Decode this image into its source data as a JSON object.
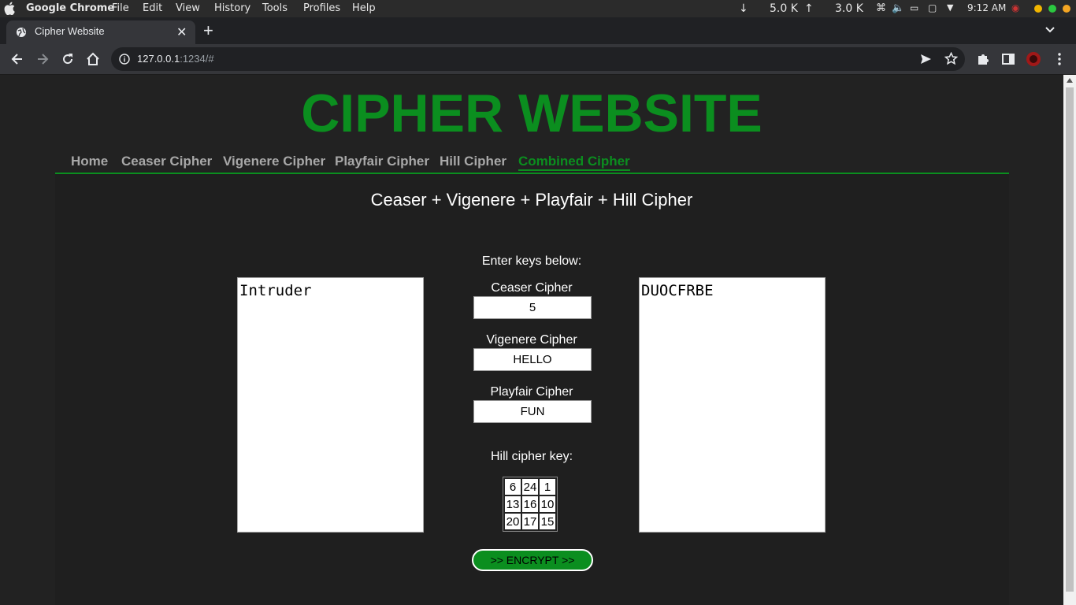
{
  "menubar": {
    "app_name": "Google Chrome",
    "items": [
      "File",
      "Edit",
      "View",
      "History",
      "Tools",
      "Profiles",
      "Help"
    ],
    "download_speed": "5.0 K",
    "upload_speed": "3.0 K",
    "time": "9:12 AM"
  },
  "browser": {
    "tab_title": "Cipher Website",
    "url_host": "127.0.0.1",
    "url_rest": ":1234/#"
  },
  "site": {
    "title": "CIPHER WEBSITE",
    "nav": [
      "Home",
      "Ceaser Cipher",
      "Vigenere Cipher",
      "Playfair Cipher",
      "Hill Cipher",
      "Combined Cipher"
    ],
    "active_nav": "Combined Cipher",
    "subtitle": "Ceaser + Vigenere + Playfair + Hill Cipher",
    "keys_label": "Enter keys below:",
    "input_text": "Intruder",
    "output_text": "DUOCFRBE",
    "ceaser_label": "Ceaser Cipher",
    "ceaser_key": "5",
    "vigenere_label": "Vigenere Cipher",
    "vigenere_key": "HELLO",
    "playfair_label": "Playfair Cipher",
    "playfair_key": "FUN",
    "hill_label": "Hill cipher key:",
    "hill_matrix": [
      [
        "6",
        "24",
        "1"
      ],
      [
        "13",
        "16",
        "10"
      ],
      [
        "20",
        "17",
        "15"
      ]
    ],
    "encrypt_label": ">> ENCRYPT >>"
  },
  "colors": {
    "accent": "#0b8e1f",
    "page_bg": "#222222"
  }
}
